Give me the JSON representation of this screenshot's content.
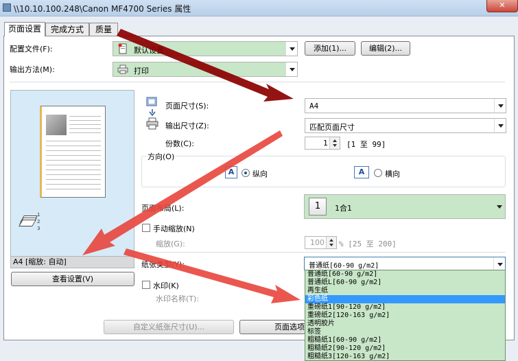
{
  "window": {
    "title": "\\\\10.10.100.248\\Canon MF4700 Series 属性",
    "close_label": "✕"
  },
  "tabs": [
    {
      "label": "页面设置"
    },
    {
      "label": "完成方式"
    },
    {
      "label": "质量"
    }
  ],
  "profile": {
    "label": "配置文件(F):",
    "value": "默认设置",
    "add_button": "添加(1)...",
    "edit_button": "编辑(2)..."
  },
  "output_method": {
    "label": "输出方法(M):",
    "value": "打印"
  },
  "preview": {
    "caption": "A4 [缩放: 自动]",
    "view_settings_button": "查看设置(V)",
    "mini_pages": "1\n2\n3"
  },
  "page_size": {
    "label": "页面尺寸(S):",
    "value": "A4"
  },
  "output_size": {
    "label": "输出尺寸(Z):",
    "value": "匹配页面尺寸"
  },
  "copies": {
    "label": "份数(C):",
    "value": "1",
    "range": "[1 至 99]"
  },
  "orientation": {
    "legend": "方向(O)",
    "portrait": "纵向",
    "landscape": "横向",
    "icon_letter": "A",
    "selected": "portrait"
  },
  "page_layout": {
    "label": "页面布局(L):",
    "value": "1合1",
    "icon_number": "1"
  },
  "manual_scaling": {
    "label": "手动缩放(N)",
    "checked": false
  },
  "scaling": {
    "label": "缩放(G):",
    "value": "100",
    "range": "% [25 至 200]"
  },
  "paper_type": {
    "label": "纸张类型(Y):",
    "value": "普通纸[60-90 g/m2]",
    "options": [
      "普通纸[60-90 g/m2]",
      "普通纸L[60-90 g/m2]",
      "再生纸",
      "彩色纸",
      "重磅纸1[90-120 g/m2]",
      "重磅纸2[120-163 g/m2]",
      "透明胶片",
      "标签",
      "粗糙纸1[60-90 g/m2]",
      "粗糙纸2[90-120 g/m2]",
      "粗糙纸3[120-163 g/m2]"
    ],
    "highlighted_index": 3
  },
  "watermark": {
    "label": "水印(K)",
    "checked": false,
    "name_label": "水印名称(T):"
  },
  "bottom": {
    "custom_size_button": "自定义纸张尺寸(U)...",
    "page_options_button": "页面选项"
  },
  "colors": {
    "green_field": "#c8e6c8",
    "highlight": "#3399ff",
    "annotation_arrow_dark": "#8b0000",
    "annotation_arrow_red": "#e8453c"
  }
}
